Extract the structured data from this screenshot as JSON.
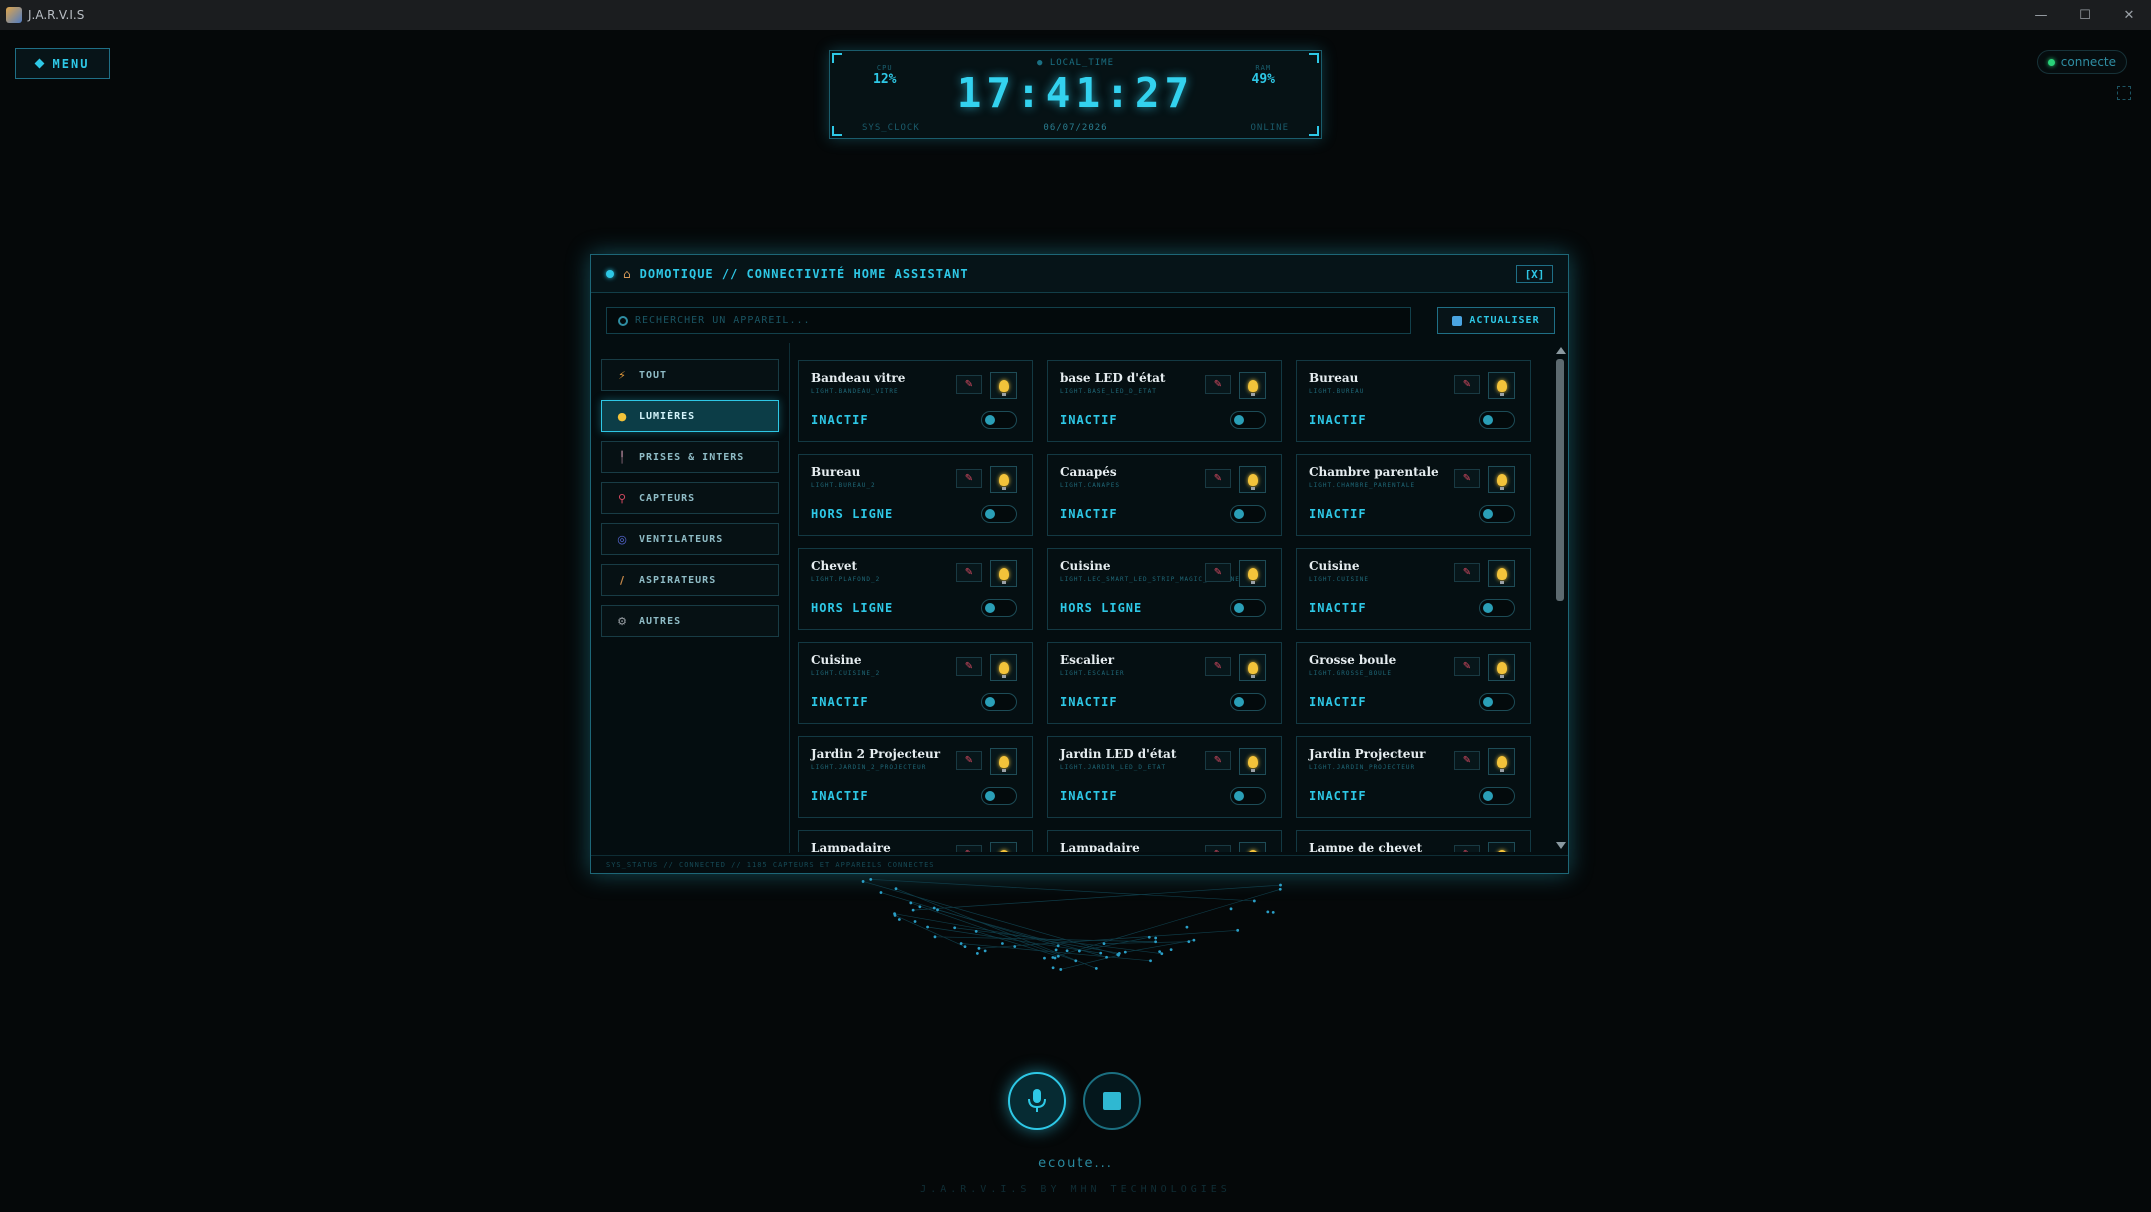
{
  "window": {
    "title": "J.A.R.V.I.S",
    "minimize": "—",
    "maximize": "☐",
    "close": "✕"
  },
  "menu": {
    "label": "MENU"
  },
  "connection": {
    "label": "connecte"
  },
  "clock": {
    "local_label": "LOCAL_TIME",
    "time": "17:41:27",
    "cpu_label": "CPU",
    "cpu_value": "12%",
    "ram_label": "RAM",
    "ram_value": "49%",
    "sys_label": "SYS_CLOCK",
    "date": "06/07/2026",
    "status": "ONLINE"
  },
  "panel": {
    "title": "DOMOTIQUE // CONNECTIVITÉ HOME ASSISTANT",
    "close_label": "[X]",
    "search_placeholder": "RECHERCHER UN APPAREIL...",
    "refresh_label": "ACTUALISER",
    "footer": "SYS_STATUS // CONNECTED // 1185 CAPTEURS ET APPAREILS CONNECTES"
  },
  "categories": [
    {
      "label": "TOUT",
      "icon": "lightning-icon",
      "glyph": "⚡",
      "color": "#e39a3b",
      "active": false
    },
    {
      "label": "LUMIÈRES",
      "icon": "lightbulb-icon",
      "glyph": "●",
      "color": "#f3c33a",
      "active": true
    },
    {
      "label": "PRISES & INTERS",
      "icon": "plug-icon",
      "glyph": "╿",
      "color": "#8a6a7a",
      "active": false
    },
    {
      "label": "CAPTEURS",
      "icon": "thermometer-icon",
      "glyph": "⚲",
      "color": "#d84a62",
      "active": false
    },
    {
      "label": "VENTILATEURS",
      "icon": "fan-icon",
      "glyph": "◎",
      "color": "#5b6de0",
      "active": false
    },
    {
      "label": "ASPIRATEURS",
      "icon": "broom-icon",
      "glyph": "/",
      "color": "#c98a4a",
      "active": false
    },
    {
      "label": "AUTRES",
      "icon": "gear-icon",
      "glyph": "⚙",
      "color": "#9aa0a6",
      "active": false
    }
  ],
  "devices": [
    {
      "name": "Bandeau vitre",
      "entity": "LIGHT.BANDEAU_VITRE",
      "state": "INACTIF"
    },
    {
      "name": "base LED d'état",
      "entity": "LIGHT.BASE_LED_D_ETAT",
      "state": "INACTIF"
    },
    {
      "name": "Bureau",
      "entity": "LIGHT.BUREAU",
      "state": "INACTIF"
    },
    {
      "name": "Bureau",
      "entity": "LIGHT.BUREAU_2",
      "state": "HORS LIGNE"
    },
    {
      "name": "Canapés",
      "entity": "LIGHT.CANAPES",
      "state": "INACTIF"
    },
    {
      "name": "Chambre parentale",
      "entity": "LIGHT.CHAMBRE_PARENTALE",
      "state": "INACTIF"
    },
    {
      "name": "Chevet",
      "entity": "LIGHT.PLAFOND_2",
      "state": "HORS LIGNE"
    },
    {
      "name": "Cuisine",
      "entity": "LIGHT.LEC_SMART_LED_STRIP_MAGIC_CUISINE",
      "state": "HORS LIGNE"
    },
    {
      "name": "Cuisine",
      "entity": "LIGHT.CUISINE",
      "state": "INACTIF"
    },
    {
      "name": "Cuisine",
      "entity": "LIGHT.CUISINE_2",
      "state": "INACTIF"
    },
    {
      "name": "Escalier",
      "entity": "LIGHT.ESCALIER",
      "state": "INACTIF"
    },
    {
      "name": "Grosse boule",
      "entity": "LIGHT.GROSSE_BOULE",
      "state": "INACTIF"
    },
    {
      "name": "Jardin 2 Projecteur",
      "entity": "LIGHT.JARDIN_2_PROJECTEUR",
      "state": "INACTIF"
    },
    {
      "name": "Jardin LED d'état",
      "entity": "LIGHT.JARDIN_LED_D_ETAT",
      "state": "INACTIF"
    },
    {
      "name": "Jardin Projecteur",
      "entity": "LIGHT.JARDIN_PROJECTEUR",
      "state": "INACTIF"
    },
    {
      "name": "Lampadaire",
      "entity": "",
      "state": ""
    },
    {
      "name": "Lampadaire",
      "entity": "",
      "state": ""
    },
    {
      "name": "Lampe de chevet",
      "entity": "",
      "state": ""
    }
  ],
  "voice": {
    "status": "ecoute...",
    "credits": "J.A.R.V.I.S  BY MHN TECHNOLOGIES"
  },
  "colors": {
    "accent": "#2ec8e6",
    "background": "#050809",
    "bulb": "#f3c33a",
    "pin": "#d84a62"
  }
}
